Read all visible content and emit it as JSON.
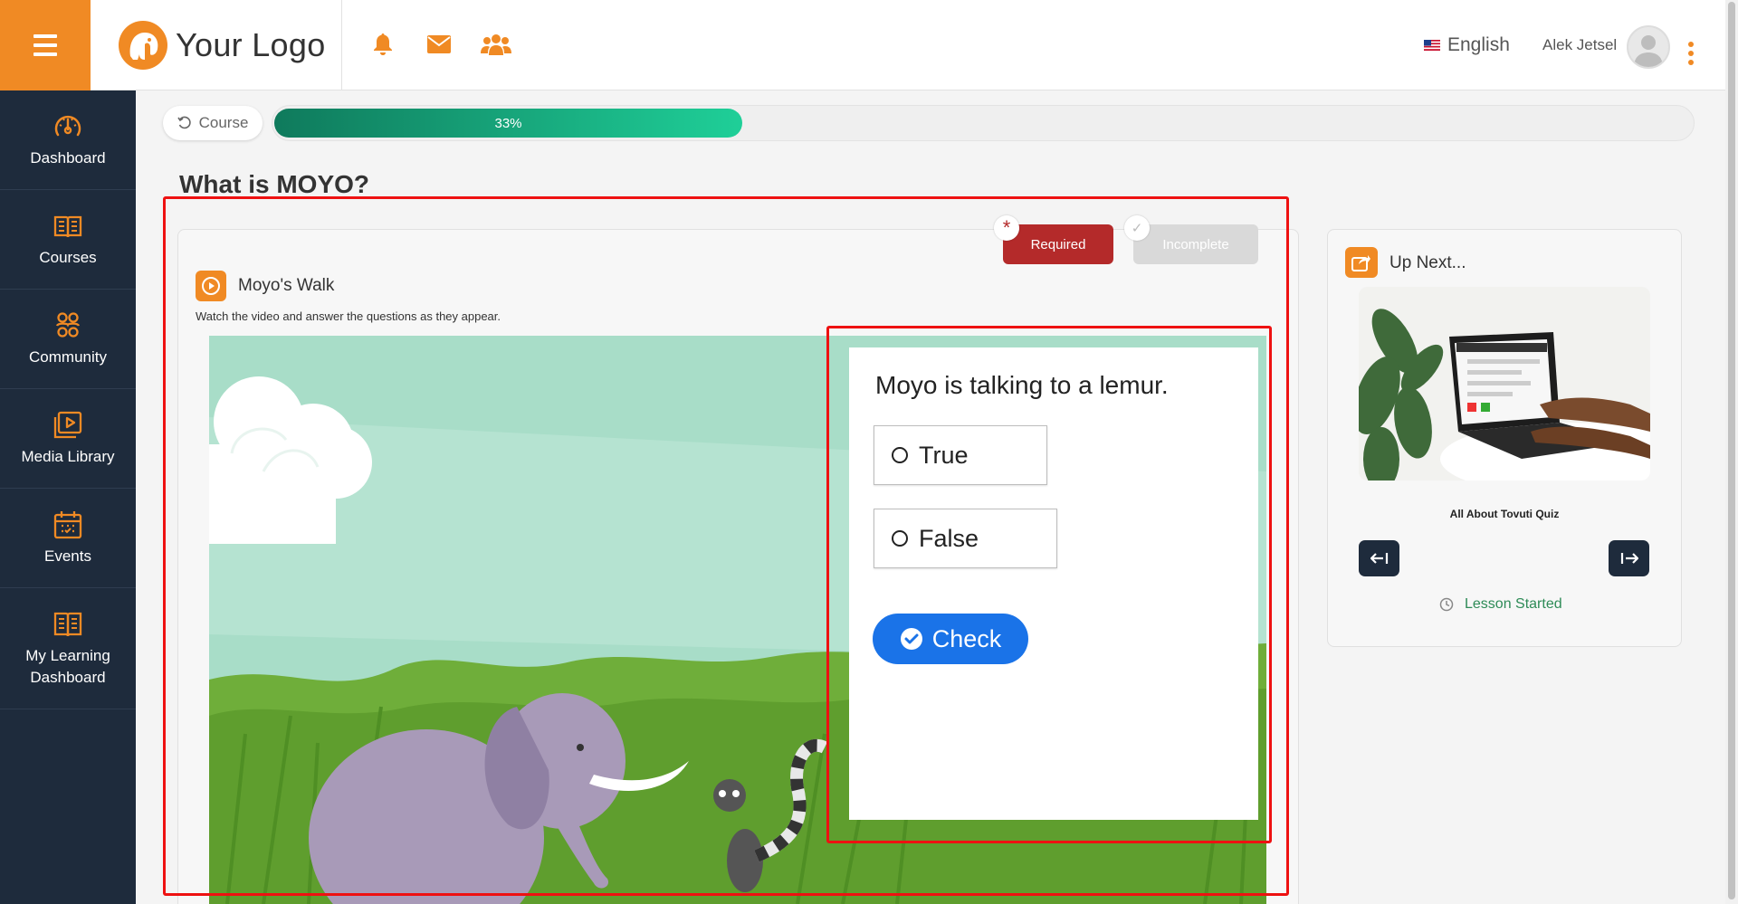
{
  "header": {
    "logo_text": "Your Logo",
    "language": "English",
    "user_name": "Alek Jetsel",
    "icons": [
      "bell-icon",
      "envelope-icon",
      "users-icon"
    ],
    "accent_color": "#f08a24"
  },
  "sidebar": {
    "items": [
      {
        "label": "Dashboard",
        "icon": "speedometer-icon"
      },
      {
        "label": "Courses",
        "icon": "book-icon"
      },
      {
        "label": "Community",
        "icon": "community-icon"
      },
      {
        "label": "Media Library",
        "icon": "media-library-icon"
      },
      {
        "label": "Events",
        "icon": "calendar-icon"
      },
      {
        "label": "My Learning Dashboard",
        "icon": "open-book-icon"
      }
    ]
  },
  "progress": {
    "back_label": "Course",
    "percent_label": "33%",
    "value": 0.33
  },
  "lesson": {
    "title": "What is MOYO?",
    "badges": {
      "required": "Required",
      "incomplete": "Incomplete"
    },
    "section_title": "Moyo's Walk",
    "section_description": "Watch the video and answer the questions as they appear."
  },
  "quiz": {
    "question": "Moyo is talking to a lemur.",
    "options": [
      "True",
      "False"
    ],
    "check_label": "Check"
  },
  "up_next": {
    "title": "Up Next...",
    "item_title": "All About Tovuti Quiz",
    "status": "Lesson Started"
  }
}
